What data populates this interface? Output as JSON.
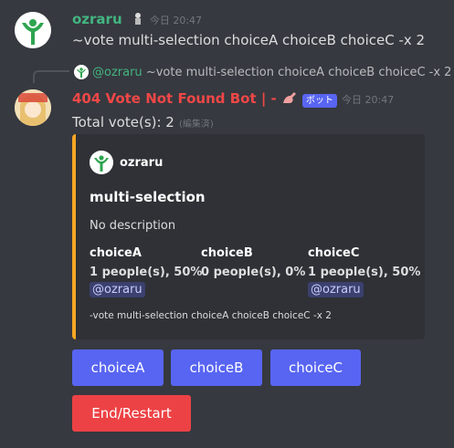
{
  "message1": {
    "username": "ozraru",
    "timestamp": "今日 20:47",
    "text": "~vote multi-selection choiceA choiceB choiceC -x 2"
  },
  "reply": {
    "mention": "@ozraru",
    "text": "~vote multi-selection choiceA choiceB choiceC -x 2"
  },
  "message2": {
    "botname": "404 Vote Not Found Bot | -",
    "badge": "ボット",
    "timestamp": "今日 20:47",
    "total": "Total vote(s): 2",
    "edited": "(編集済)"
  },
  "embed": {
    "author": "ozraru",
    "title": "multi-selection",
    "description": "No description",
    "fields": [
      {
        "name": "choiceA",
        "value": "1 people(s), 50%",
        "mention": "@ozraru"
      },
      {
        "name": "choiceB",
        "value": "0 people(s), 0%",
        "mention": ""
      },
      {
        "name": "choiceC",
        "value": "1 people(s), 50%",
        "mention": "@ozraru"
      }
    ],
    "footer": "-vote multi-selection choiceA choiceB choiceC -x 2",
    "accent": "#f5a623"
  },
  "buttons": {
    "choices": [
      "choiceA",
      "choiceB",
      "choiceC"
    ],
    "end": "End/Restart",
    "primary_color": "#5865f2",
    "danger_color": "#ed4245"
  }
}
